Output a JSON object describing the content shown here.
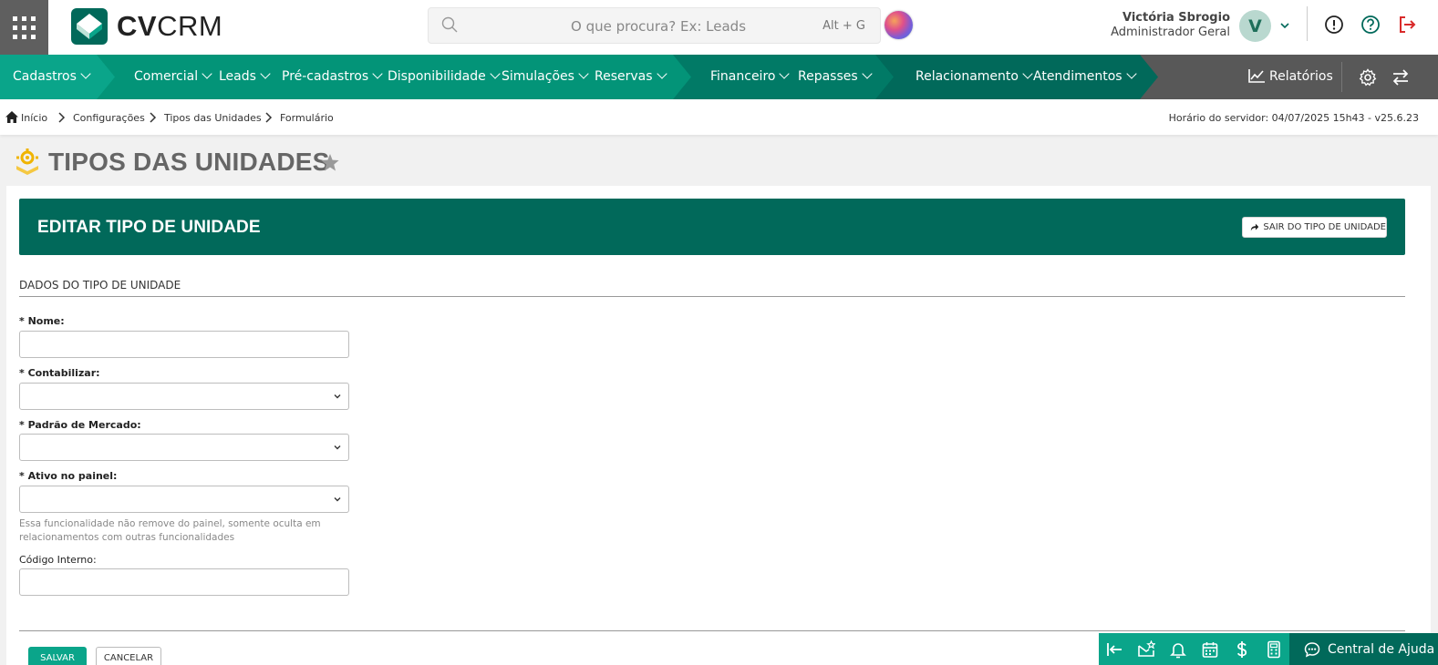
{
  "header": {
    "logo_bold": "CV",
    "logo_light": "CRM",
    "search_placeholder": "O que procura? Ex: Leads",
    "search_shortcut": "Alt + G",
    "user_name": "Victória Sbrogio",
    "user_role": "Administrador Geral",
    "avatar_initial": "V"
  },
  "nav": {
    "items": [
      "Cadastros",
      "Comercial",
      "Leads",
      "Pré-cadastros",
      "Disponibilidade",
      "Simulações",
      "Reservas",
      "Financeiro",
      "Repasses",
      "Relacionamento",
      "Atendimentos"
    ],
    "reports": "Relatórios"
  },
  "breadcrumb": {
    "items": [
      "Início",
      "Configurações",
      "Tipos das Unidades",
      "Formulário"
    ],
    "server_time": "Horário do servidor: 04/07/2025 15h43 - v25.6.23"
  },
  "page": {
    "title": "TIPOS DAS UNIDADES"
  },
  "panel": {
    "title": "EDITAR TIPO DE UNIDADE",
    "exit_button": "SAIR DO TIPO DE UNIDADE",
    "section_title": "DADOS DO TIPO DE UNIDADE"
  },
  "form": {
    "nome_label": "* Nome:",
    "nome_value": "",
    "contabilizar_label": "* Contabilizar:",
    "contabilizar_value": "",
    "padrao_label": "* Padrão de Mercado:",
    "padrao_value": "",
    "ativo_label": "* Ativo no painel:",
    "ativo_value": "",
    "ativo_help": "Essa funcionalidade não remove do painel, somente oculta em relacionamentos com outras funcionalidades",
    "codigo_label": "Código Interno:",
    "codigo_value": "",
    "save": "SALVAR",
    "cancel": "CANCELAR"
  },
  "dock": {
    "help_center": "Central de Ajuda"
  },
  "colors": {
    "brand_dark": "#01695a",
    "brand_bright": "#0aa58a",
    "nav_gray": "#585858",
    "logout_red": "#d92b2b"
  }
}
